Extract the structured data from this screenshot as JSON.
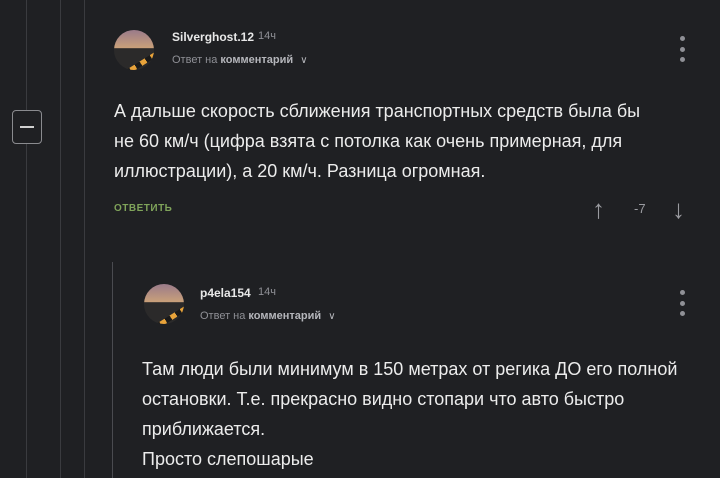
{
  "comments": [
    {
      "username": "Silverghost.12",
      "time": "14ч",
      "reply_prefix": "Ответ на",
      "reply_target": "комментарий",
      "text_lines": [
        "А дальше скорость сближения транспортных средств была бы",
        "не 60 км/ч (цифра взята с потолка как очень примерная, для",
        "иллюстрации), а 20 км/ч. Разница огромная."
      ],
      "reply_label": "ОТВЕТИТЬ",
      "rating": "-7"
    },
    {
      "username": "p4ela154",
      "time": "14ч",
      "reply_prefix": "Ответ на",
      "reply_target": "комментарий",
      "text_lines": [
        "Там люди были минимум в 150 метрах от регика ДО его полной",
        "остановки. Т.е. прекрасно видно стопари что авто быстро",
        "приближается.",
        "Просто слепошарые"
      ]
    }
  ],
  "icons": {
    "up_arrow": "↑",
    "down_arrow": "↓",
    "chevron": "∨"
  }
}
